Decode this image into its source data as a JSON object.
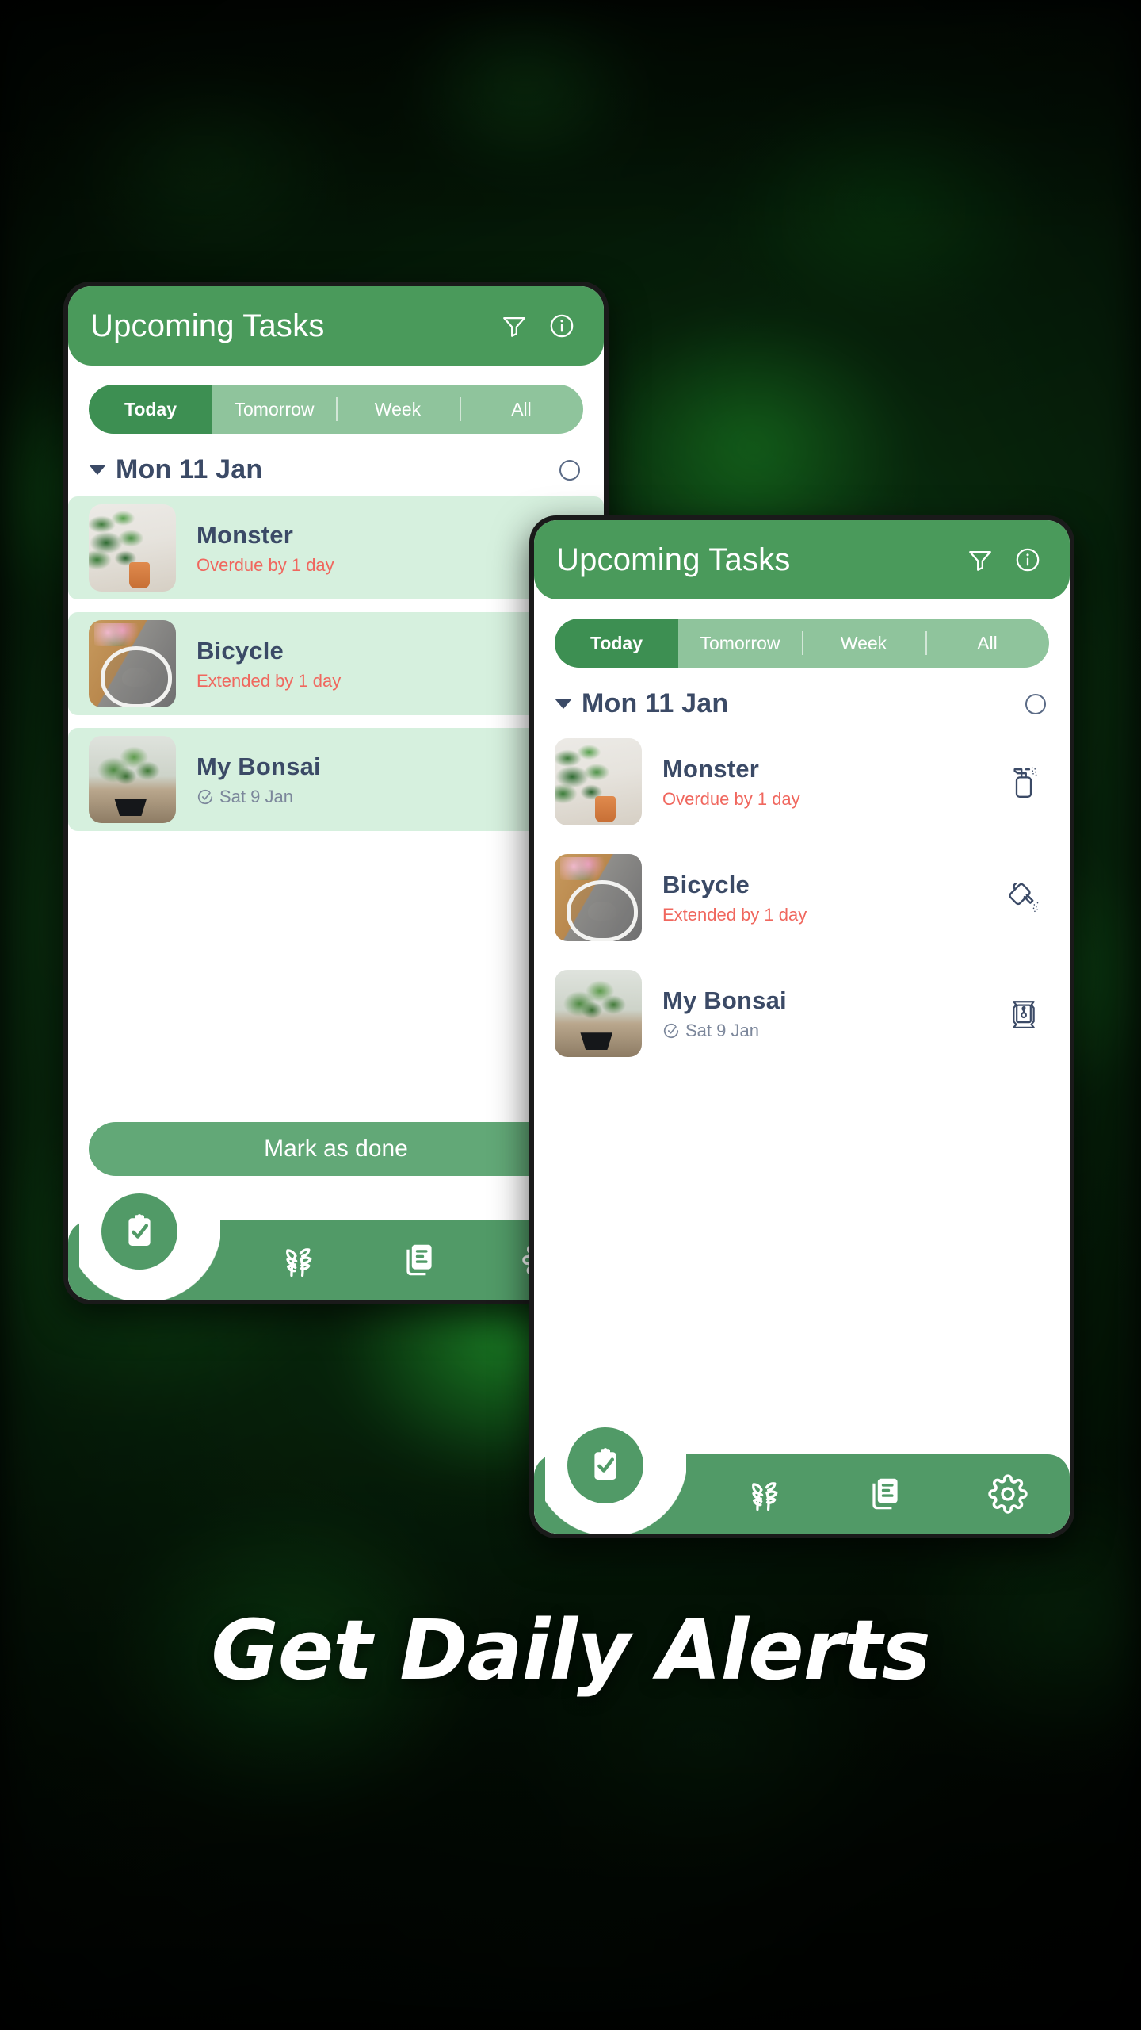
{
  "headline": "Get Daily Alerts",
  "app": {
    "header": {
      "title": "Upcoming Tasks",
      "filter_icon": "filter-funnel-icon",
      "info_icon": "info-circle-icon"
    },
    "tabs": [
      {
        "label": "Today",
        "active": true
      },
      {
        "label": "Tomorrow",
        "active": false
      },
      {
        "label": "Week",
        "active": false
      },
      {
        "label": "All",
        "active": false
      }
    ],
    "date_group": {
      "label": "Mon 11 Jan",
      "caret_icon": "chevron-down-icon",
      "select_all_icon": "circle-unchecked-icon"
    },
    "tasks": [
      {
        "name": "Monster",
        "status": "Overdue by 1 day",
        "status_tone": "overdue",
        "action_icon": "spray-bottle-icon",
        "thumb": "monstera-plant-photo"
      },
      {
        "name": "Bicycle",
        "status": "Extended by 1 day",
        "status_tone": "overdue",
        "action_icon": "watering-can-icon",
        "thumb": "bicycle-with-flowers-photo"
      },
      {
        "name": "My Bonsai",
        "status": "Sat 9 Jan",
        "status_tone": "done",
        "status_icon": "check-circle-icon",
        "action_icon": "fertilizer-bag-icon",
        "thumb": "bonsai-tree-photo"
      }
    ],
    "mark_done_label": "Mark as done",
    "bottom_nav": {
      "fab_icon": "clipboard-check-icon",
      "items": [
        {
          "icon": "plants-icon"
        },
        {
          "icon": "journal-icon"
        },
        {
          "icon": "gear-icon"
        }
      ]
    }
  },
  "colors": {
    "brand_green": "#4a9a5b",
    "tab_active": "#3d8f52",
    "tab_track": "#8fc49c",
    "nav_green": "#519a67",
    "button_green": "#62a877",
    "text_navy": "#3b4a66",
    "status_red": "#f0675e",
    "row_highlight": "#d6f0de"
  }
}
